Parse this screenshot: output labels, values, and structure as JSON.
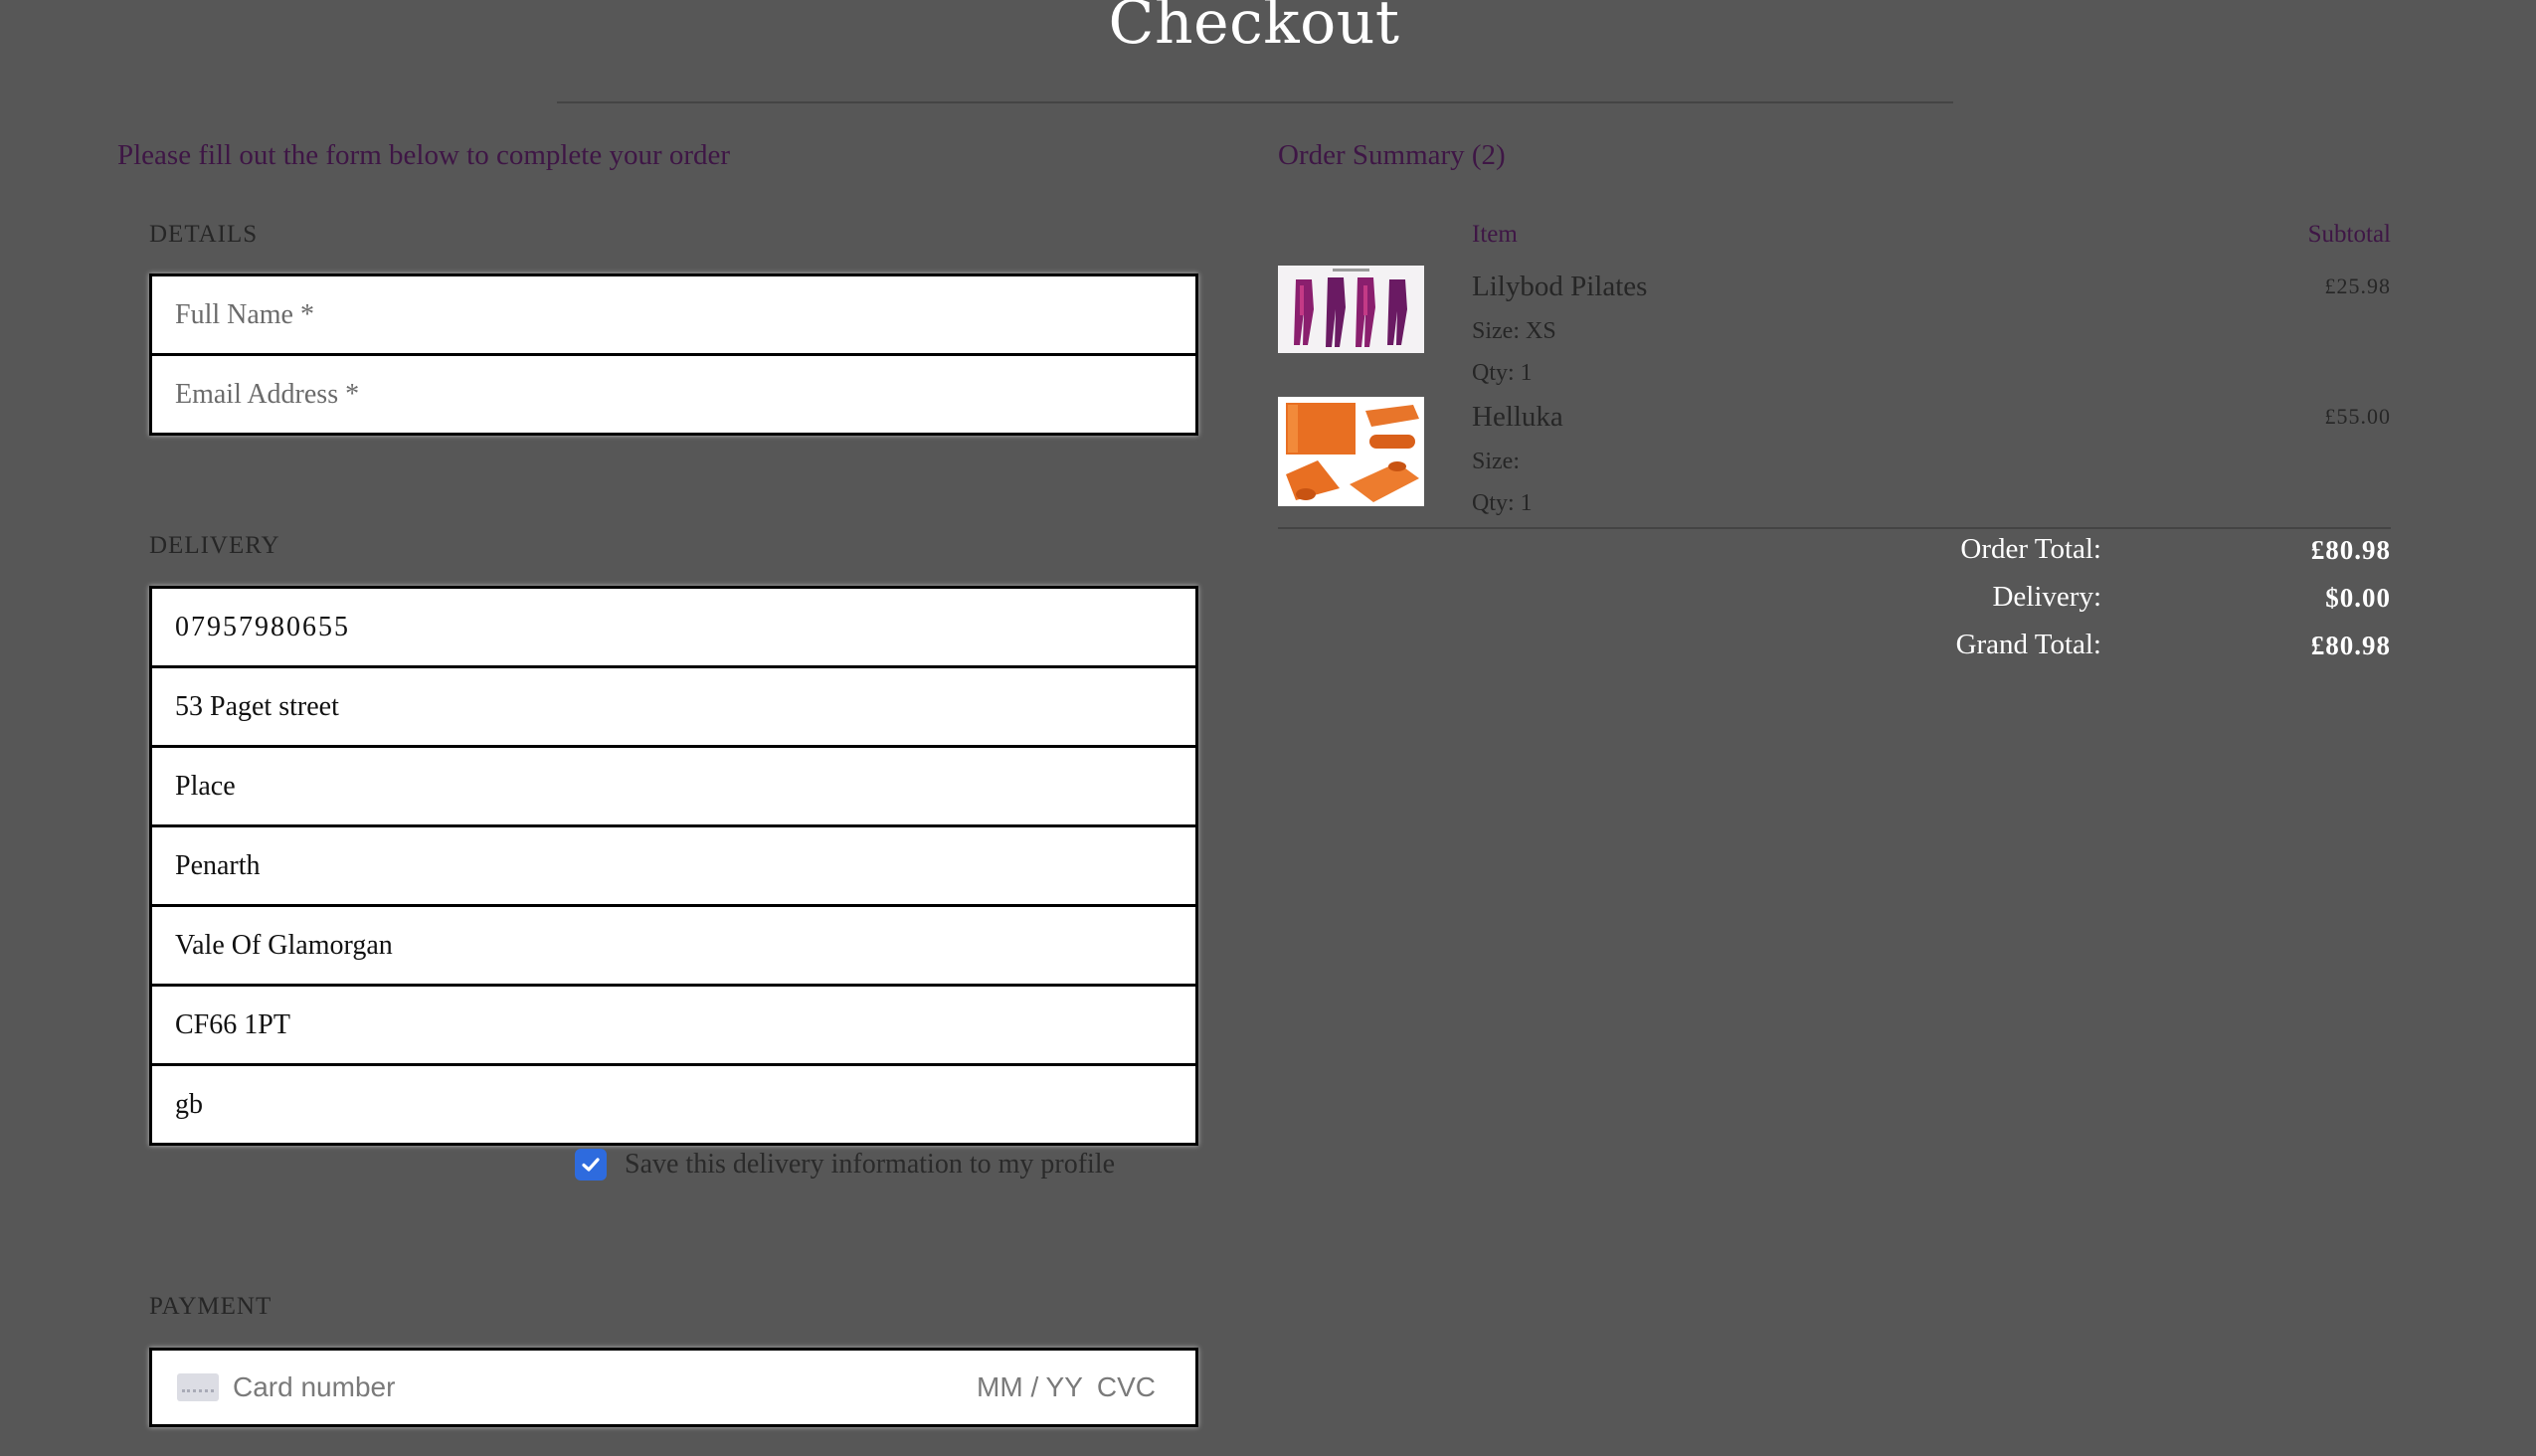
{
  "page": {
    "title": "Checkout"
  },
  "form": {
    "intro": "Please fill out the form below to complete your order",
    "details": {
      "label": "DETAILS",
      "full_name_placeholder": "Full Name *",
      "email_placeholder": "Email Address *"
    },
    "delivery": {
      "label": "DELIVERY",
      "phone": "07957980655",
      "street_address_1": "53 Paget street",
      "street_address_2": "Place",
      "town_or_city": "Penarth",
      "county": "Vale Of Glamorgan",
      "postcode": "CF66 1PT",
      "country": "gb",
      "save_info_label": "Save this delivery information to my profile",
      "save_info_checked": true
    },
    "payment": {
      "label": "PAYMENT",
      "card_number_placeholder": "Card number",
      "expiry_placeholder": "MM / YY",
      "cvc_placeholder": "CVC"
    }
  },
  "summary": {
    "heading": "Order Summary (2)",
    "col_item": "Item",
    "col_subtotal": "Subtotal",
    "items": [
      {
        "name": "Lilybod Pilates",
        "size": "Size: XS",
        "qty": "Qty: 1",
        "subtotal": "£25.98",
        "image_icon": "leggings-image"
      },
      {
        "name": "Helluka",
        "size": "Size:",
        "qty": "Qty: 1",
        "subtotal": "£55.00",
        "image_icon": "yoga-mat-image"
      }
    ],
    "order_total_label": "Order Total:",
    "order_total": "£80.98",
    "delivery_label": "Delivery:",
    "delivery": "$0.00",
    "grand_total_label": "Grand Total:",
    "grand_total": "£80.98"
  },
  "colors": {
    "background": "#575757",
    "accent_text": "#3e1645",
    "checkbox": "#2e6bde"
  }
}
